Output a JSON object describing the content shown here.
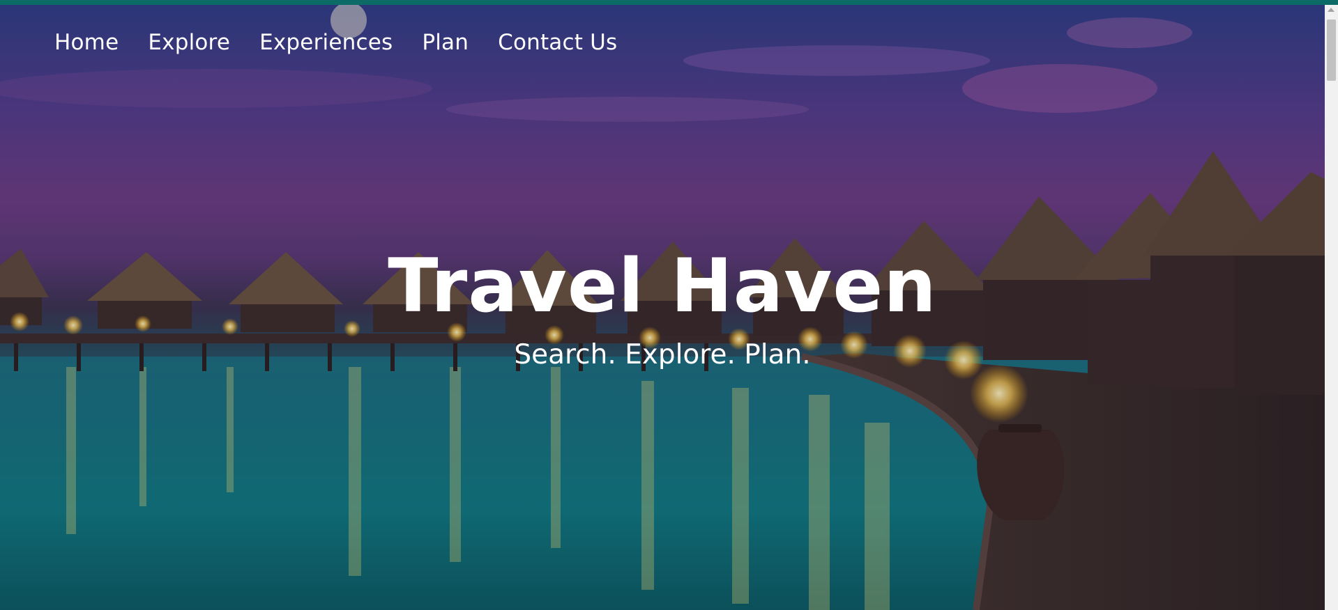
{
  "nav": {
    "items": [
      {
        "label": "Home"
      },
      {
        "label": "Explore"
      },
      {
        "label": "Experiences"
      },
      {
        "label": "Plan"
      },
      {
        "label": "Contact Us"
      }
    ]
  },
  "hero": {
    "title": "Travel Haven",
    "subtitle": "Search. Explore. Plan."
  },
  "colors": {
    "top_bar": "#0d6b67",
    "text": "#ffffff",
    "scrollbar_track": "#f1f1f1",
    "scrollbar_thumb": "#c1c1c1"
  }
}
